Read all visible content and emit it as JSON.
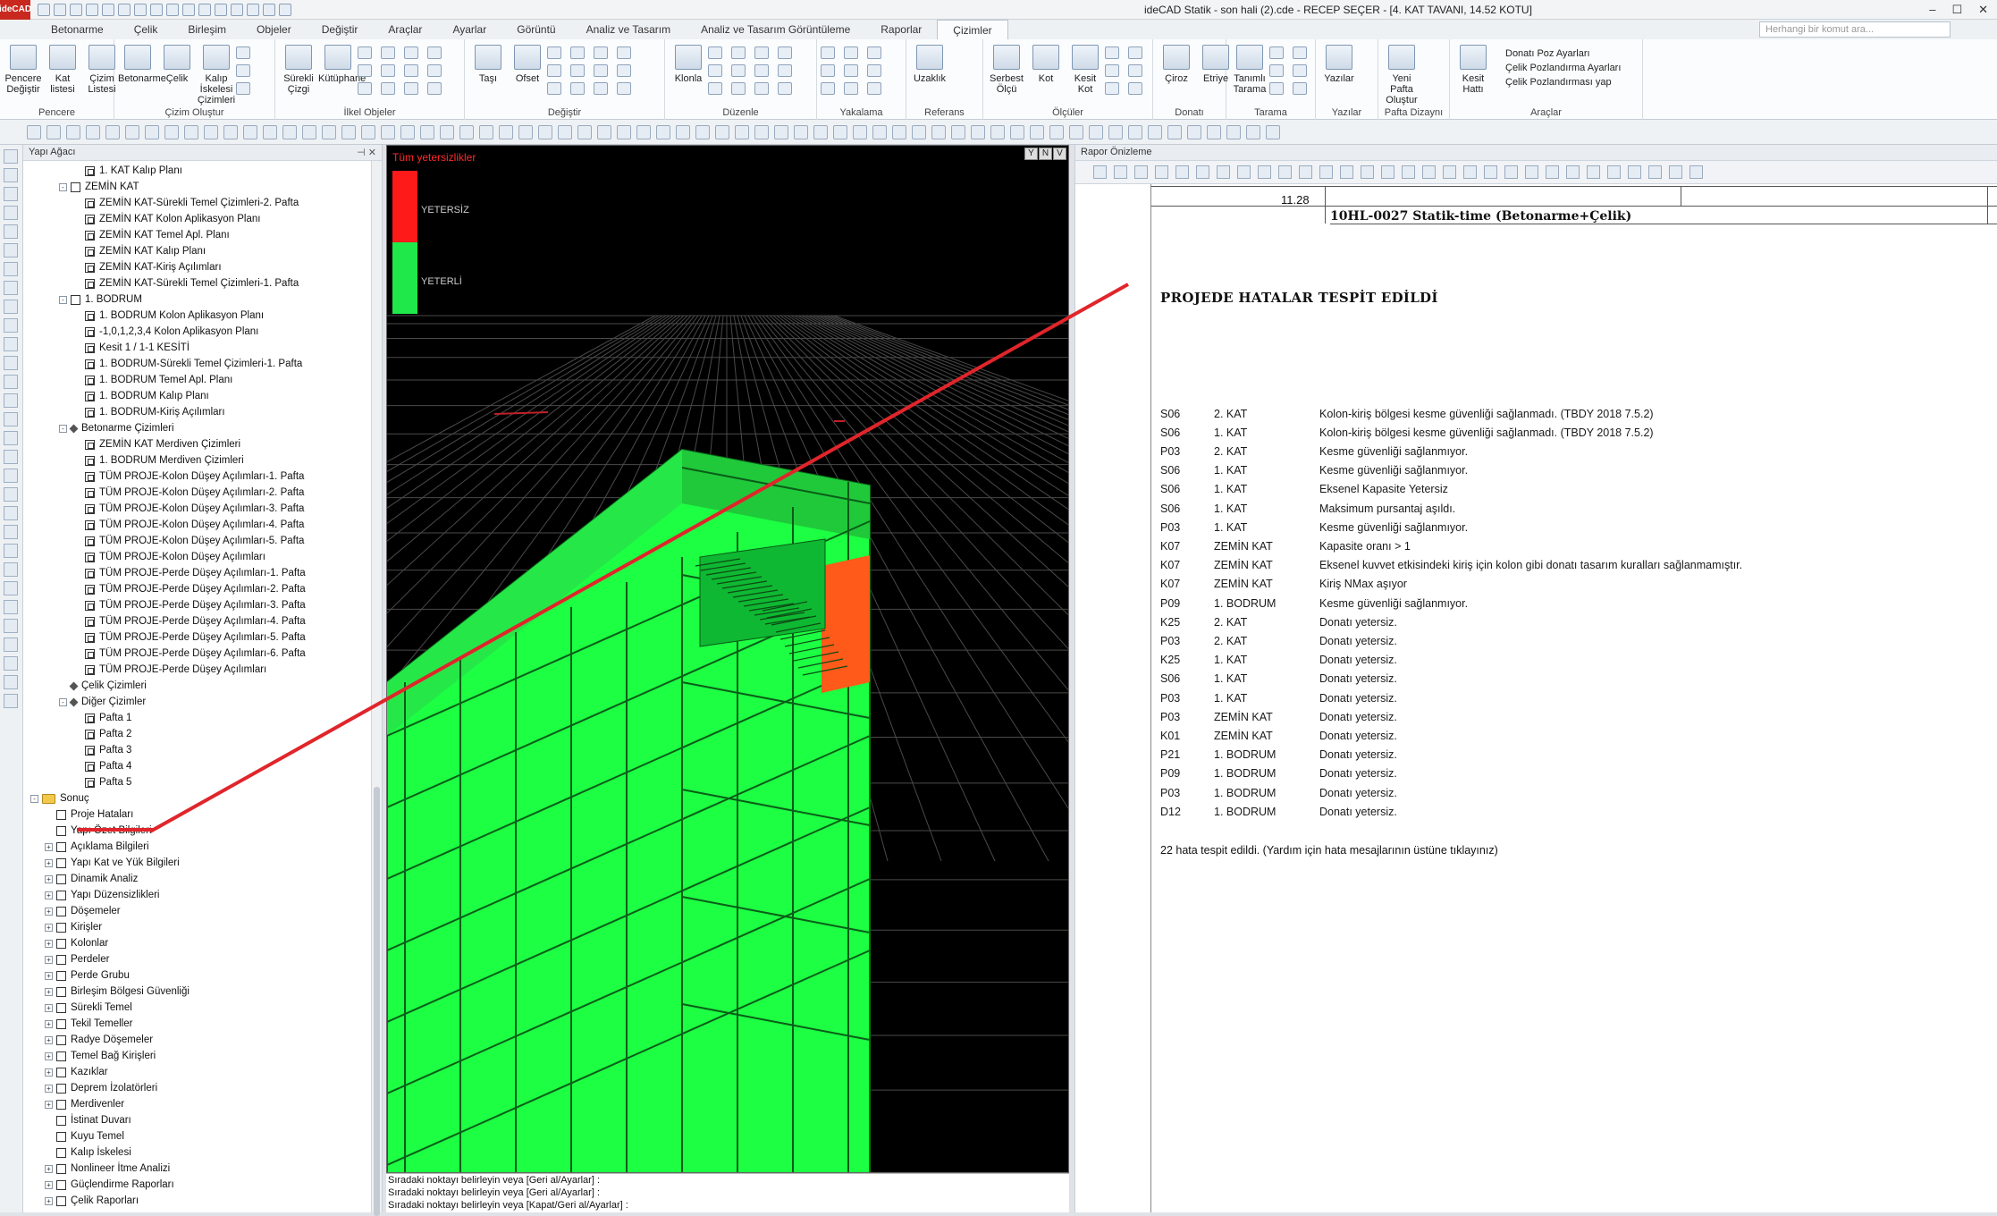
{
  "app": {
    "logo": "ideCAD",
    "window_title": "ideCAD Statik - son hali (2).cde - RECEP SEÇER  - [4. KAT TAVANI, 14.52 KOTU]",
    "command_placeholder": "Herhangi bir komut ara..."
  },
  "ribbon_tabs": [
    "Betonarme",
    "Çelik",
    "Birleşim",
    "Objeler",
    "Değiştir",
    "Araçlar",
    "Ayarlar",
    "Görüntü",
    "Analiz ve Tasarım",
    "Analiz ve Tasarım Görüntüleme",
    "Raporlar",
    "Çizimler"
  ],
  "ribbon_groups": [
    {
      "label": "Pencere",
      "buttons": [
        "Pencere Değiştir",
        "Kat listesi",
        "Çizim Listesi"
      ]
    },
    {
      "label": "Çizim Oluştur",
      "buttons": [
        "Betonarme",
        "Çelik",
        "Kalıp İskelesi Çizimleri"
      ]
    },
    {
      "label": "İlkel Objeler",
      "buttons": [
        "Sürekli Çizgi",
        "Kütüphane"
      ]
    },
    {
      "label": "Değiştir",
      "buttons": [
        "Taşı",
        "Ofset"
      ]
    },
    {
      "label": "Düzenle",
      "buttons": [
        "Klonla"
      ]
    },
    {
      "label": "Yakalama",
      "buttons": []
    },
    {
      "label": "Referans",
      "buttons": [
        "Uzaklık"
      ]
    },
    {
      "label": "Ölçüler",
      "buttons": [
        "Serbest Ölçü",
        "Kot",
        "Kesit Kot"
      ]
    },
    {
      "label": "Donatı",
      "buttons": [
        "Çiroz",
        "Etriye"
      ]
    },
    {
      "label": "Tarama",
      "buttons": [
        "Tanımlı Tarama"
      ]
    },
    {
      "label": "Yazılar",
      "buttons": [
        "Yazılar"
      ]
    },
    {
      "label": "Pafta Dizaynı",
      "buttons": [
        "Yeni Pafta Oluştur"
      ]
    },
    {
      "label": "Araçlar",
      "buttons": [
        "Kesit Hattı"
      ],
      "links": [
        "Donatı Poz Ayarları",
        "Çelik Pozlandırma Ayarları",
        "Çelik Pozlandırması yap"
      ]
    }
  ],
  "left_panel": {
    "title": "Yapı Ağacı",
    "tree": [
      {
        "t": "1. KAT Kalıp Planı",
        "lvl": 3,
        "icon": "plan"
      },
      {
        "t": "ZEMİN KAT",
        "lvl": 2,
        "icon": "box",
        "exp": "-"
      },
      {
        "t": "ZEMİN KAT-Sürekli Temel Çizimleri-2. Pafta",
        "lvl": 3,
        "icon": "plan"
      },
      {
        "t": "ZEMİN KAT Kolon Aplikasyon Planı",
        "lvl": 3,
        "icon": "plan"
      },
      {
        "t": "ZEMİN KAT Temel Apl. Planı",
        "lvl": 3,
        "icon": "plan"
      },
      {
        "t": "ZEMİN KAT Kalıp Planı",
        "lvl": 3,
        "icon": "plan"
      },
      {
        "t": "ZEMİN KAT-Kiriş Açılımları",
        "lvl": 3,
        "icon": "plan"
      },
      {
        "t": "ZEMİN KAT-Sürekli Temel Çizimleri-1. Pafta",
        "lvl": 3,
        "icon": "plan"
      },
      {
        "t": "1. BODRUM",
        "lvl": 2,
        "icon": "box",
        "exp": "-"
      },
      {
        "t": "1. BODRUM Kolon Aplikasyon Planı",
        "lvl": 3,
        "icon": "plan"
      },
      {
        "t": "-1,0,1,2,3,4 Kolon Aplikasyon Planı",
        "lvl": 3,
        "icon": "plan"
      },
      {
        "t": "Kesit 1 / 1-1 KESİTİ",
        "lvl": 3,
        "icon": "plan"
      },
      {
        "t": "1. BODRUM-Sürekli Temel Çizimleri-1. Pafta",
        "lvl": 3,
        "icon": "plan"
      },
      {
        "t": "1. BODRUM Temel Apl. Planı",
        "lvl": 3,
        "icon": "plan"
      },
      {
        "t": "1. BODRUM Kalıp Planı",
        "lvl": 3,
        "icon": "plan"
      },
      {
        "t": "1. BODRUM-Kiriş Açılımları",
        "lvl": 3,
        "icon": "plan"
      },
      {
        "t": "Betonarme Çizimleri",
        "lvl": 2,
        "icon": "dot",
        "exp": "-"
      },
      {
        "t": "ZEMİN KAT Merdiven Çizimleri",
        "lvl": 3,
        "icon": "plan"
      },
      {
        "t": "1. BODRUM Merdiven Çizimleri",
        "lvl": 3,
        "icon": "plan"
      },
      {
        "t": "TÜM PROJE-Kolon Düşey Açılımları-1. Pafta",
        "lvl": 3,
        "icon": "plan"
      },
      {
        "t": "TÜM PROJE-Kolon Düşey Açılımları-2. Pafta",
        "lvl": 3,
        "icon": "plan"
      },
      {
        "t": "TÜM PROJE-Kolon Düşey Açılımları-3. Pafta",
        "lvl": 3,
        "icon": "plan"
      },
      {
        "t": "TÜM PROJE-Kolon Düşey Açılımları-4. Pafta",
        "lvl": 3,
        "icon": "plan"
      },
      {
        "t": "TÜM PROJE-Kolon Düşey Açılımları-5. Pafta",
        "lvl": 3,
        "icon": "plan"
      },
      {
        "t": "TÜM PROJE-Kolon Düşey Açılımları",
        "lvl": 3,
        "icon": "plan"
      },
      {
        "t": "TÜM PROJE-Perde Düşey Açılımları-1. Pafta",
        "lvl": 3,
        "icon": "plan"
      },
      {
        "t": "TÜM PROJE-Perde Düşey Açılımları-2. Pafta",
        "lvl": 3,
        "icon": "plan"
      },
      {
        "t": "TÜM PROJE-Perde Düşey Açılımları-3. Pafta",
        "lvl": 3,
        "icon": "plan"
      },
      {
        "t": "TÜM PROJE-Perde Düşey Açılımları-4. Pafta",
        "lvl": 3,
        "icon": "plan"
      },
      {
        "t": "TÜM PROJE-Perde Düşey Açılımları-5. Pafta",
        "lvl": 3,
        "icon": "plan"
      },
      {
        "t": "TÜM PROJE-Perde Düşey Açılımları-6. Pafta",
        "lvl": 3,
        "icon": "plan"
      },
      {
        "t": "TÜM PROJE-Perde Düşey Açılımları",
        "lvl": 3,
        "icon": "plan"
      },
      {
        "t": "Çelik Çizimleri",
        "lvl": 2,
        "icon": "dot"
      },
      {
        "t": "Diğer Çizimler",
        "lvl": 2,
        "icon": "dot",
        "exp": "-"
      },
      {
        "t": "Pafta 1",
        "lvl": 3,
        "icon": "plan"
      },
      {
        "t": "Pafta 2",
        "lvl": 3,
        "icon": "plan"
      },
      {
        "t": "Pafta 3",
        "lvl": 3,
        "icon": "plan"
      },
      {
        "t": "Pafta 4",
        "lvl": 3,
        "icon": "plan"
      },
      {
        "t": "Pafta 5",
        "lvl": 3,
        "icon": "plan"
      },
      {
        "t": "Sonuç",
        "lvl": 0,
        "icon": "folder",
        "exp": "-"
      },
      {
        "t": "Proje Hataları",
        "lvl": 1,
        "icon": "box"
      },
      {
        "t": "Yapı Özet Bilgileri",
        "lvl": 1,
        "icon": "box"
      },
      {
        "t": "Açıklama Bilgileri",
        "lvl": 1,
        "icon": "box",
        "exp": "+"
      },
      {
        "t": "Yapı Kat ve Yük Bilgileri",
        "lvl": 1,
        "icon": "box",
        "exp": "+"
      },
      {
        "t": "Dinamik Analiz",
        "lvl": 1,
        "icon": "box",
        "exp": "+"
      },
      {
        "t": "Yapı Düzensizlikleri",
        "lvl": 1,
        "icon": "box",
        "exp": "+"
      },
      {
        "t": "Döşemeler",
        "lvl": 1,
        "icon": "box",
        "exp": "+"
      },
      {
        "t": "Kirişler",
        "lvl": 1,
        "icon": "box",
        "exp": "+"
      },
      {
        "t": "Kolonlar",
        "lvl": 1,
        "icon": "box",
        "exp": "+"
      },
      {
        "t": "Perdeler",
        "lvl": 1,
        "icon": "box",
        "exp": "+"
      },
      {
        "t": "Perde Grubu",
        "lvl": 1,
        "icon": "box",
        "exp": "+"
      },
      {
        "t": "Birleşim Bölgesi Güvenliği",
        "lvl": 1,
        "icon": "box",
        "exp": "+"
      },
      {
        "t": "Sürekli Temel",
        "lvl": 1,
        "icon": "box",
        "exp": "+"
      },
      {
        "t": "Tekil Temeller",
        "lvl": 1,
        "icon": "box",
        "exp": "+"
      },
      {
        "t": "Radye Döşemeler",
        "lvl": 1,
        "icon": "box",
        "exp": "+"
      },
      {
        "t": "Temel Bağ Kirişleri",
        "lvl": 1,
        "icon": "box",
        "exp": "+"
      },
      {
        "t": "Kazıklar",
        "lvl": 1,
        "icon": "box",
        "exp": "+"
      },
      {
        "t": "Deprem İzolatörleri",
        "lvl": 1,
        "icon": "box",
        "exp": "+"
      },
      {
        "t": "Merdivenler",
        "lvl": 1,
        "icon": "box",
        "exp": "+"
      },
      {
        "t": "İstinat Duvarı",
        "lvl": 1,
        "icon": "box"
      },
      {
        "t": "Kuyu Temel",
        "lvl": 1,
        "icon": "box"
      },
      {
        "t": "Kalıp İskelesi",
        "lvl": 1,
        "icon": "box"
      },
      {
        "t": "Nonlineer İtme Analizi",
        "lvl": 1,
        "icon": "box",
        "exp": "+"
      },
      {
        "t": "Güçlendirme Raporları",
        "lvl": 1,
        "icon": "box",
        "exp": "+"
      },
      {
        "t": "Çelik Raporları",
        "lvl": 1,
        "icon": "box",
        "exp": "+"
      }
    ]
  },
  "viewport": {
    "label": "Tüm yetersizlikler",
    "legend_bad": "YETERSİZ",
    "legend_good": "YETERLİ",
    "buttons": [
      "Y",
      "N",
      "V"
    ],
    "status_lines": [
      "Sıradaki noktayı belirleyin veya [Geri al/Ayarlar] :",
      "Sıradaki noktayı belirleyin veya [Geri al/Ayarlar] :",
      "Sıradaki noktayı belirleyin veya [Kapat/Geri al/Ayarlar] :"
    ]
  },
  "report": {
    "panel_title": "Rapor Önizleme",
    "header_code": "10HL-0027 Statik-time (Betonarme+Çelik)",
    "header_number": "11.28",
    "title": "PROJEDE HATALAR TESPİT EDİLDİ",
    "errors": [
      [
        "S06",
        "2. KAT",
        "Kolon-kiriş bölgesi kesme güvenliği sağlanmadı. (TBDY 2018 7.5.2)"
      ],
      [
        "S06",
        "1. KAT",
        "Kolon-kiriş bölgesi kesme güvenliği sağlanmadı. (TBDY 2018 7.5.2)"
      ],
      [
        "P03",
        "2. KAT",
        "Kesme güvenliği sağlanmıyor."
      ],
      [
        "S06",
        "1. KAT",
        "Kesme güvenliği sağlanmıyor."
      ],
      [
        "S06",
        "1. KAT",
        "Eksenel Kapasite Yetersiz"
      ],
      [
        "S06",
        "1. KAT",
        "Maksimum pursantaj aşıldı."
      ],
      [
        "P03",
        "1. KAT",
        "Kesme güvenliği sağlanmıyor."
      ],
      [
        "K07",
        "ZEMİN KAT",
        "Kapasite oranı > 1"
      ],
      [
        "K07",
        "ZEMİN KAT",
        "Eksenel kuvvet etkisindeki kiriş için kolon gibi donatı tasarım kuralları sağlanmamıştır."
      ],
      [
        "K07",
        "ZEMİN KAT",
        "Kiriş NMax aşıyor"
      ],
      [
        "P09",
        "1. BODRUM",
        "Kesme güvenliği sağlanmıyor."
      ],
      [
        "K25",
        "2. KAT",
        "Donatı yetersiz."
      ],
      [
        "P03",
        "2. KAT",
        "Donatı yetersiz."
      ],
      [
        "K25",
        "1. KAT",
        "Donatı yetersiz."
      ],
      [
        "S06",
        "1. KAT",
        "Donatı yetersiz."
      ],
      [
        "P03",
        "1. KAT",
        "Donatı yetersiz."
      ],
      [
        "P03",
        "ZEMİN KAT",
        "Donatı yetersiz."
      ],
      [
        "K01",
        "ZEMİN KAT",
        "Donatı yetersiz."
      ],
      [
        "P21",
        "1. BODRUM",
        "Donatı yetersiz."
      ],
      [
        "P09",
        "1. BODRUM",
        "Donatı yetersiz."
      ],
      [
        "P03",
        "1. BODRUM",
        "Donatı yetersiz."
      ],
      [
        "D12",
        "1. BODRUM",
        "Donatı yetersiz."
      ]
    ],
    "summary": "22 hata tespit edildi. (Yardım için hata mesajlarının üstüne tıklayınız)"
  }
}
